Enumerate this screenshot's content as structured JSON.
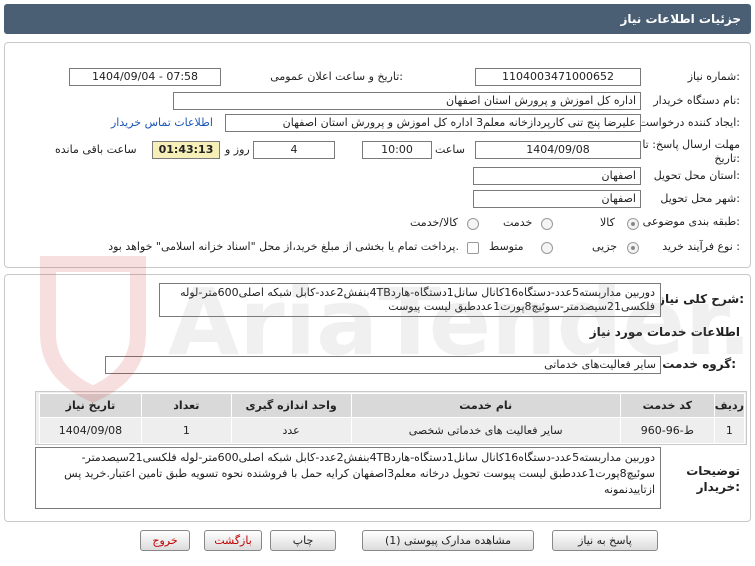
{
  "header": {
    "title": "جزئیات اطلاعات نیاز"
  },
  "fields": {
    "need_number_label": "شماره نیاز:",
    "need_number": "1104003471000652",
    "announce_label": "تاریخ و ساعت اعلان عمومی:",
    "announce_value": "1404/09/04 - 07:58",
    "buyer_label": "نام دستگاه خریدار:",
    "buyer_value": "اداره کل اموزش و پرورش استان اصفهان",
    "creator_label": "ایجاد کننده درخواست:",
    "creator_value": "علیرضا پنج تنی کارپردازخانه معلم3 اداره کل اموزش و پرورش استان اصفهان",
    "contact_link": "اطلاعات تماس خریدار",
    "deadline_label": "مهلت ارسال پاسخ: تا تاریخ:",
    "deadline_date": "1404/09/08",
    "time_label": "ساعت",
    "deadline_time": "10:00",
    "days_value": "4",
    "days_label": "روز و",
    "remaining_time": "01:43:13",
    "remaining_label": "ساعت باقی مانده",
    "province_label": "استان محل تحویل:",
    "province_value": "اصفهان",
    "city_label": "شهر محل تحویل:",
    "city_value": "اصفهان",
    "category_label": "طبقه بندی موضوعی:",
    "category_options": [
      "کالا",
      "خدمت",
      "کالا/خدمت"
    ],
    "process_label": "نوع فرآیند خرید :",
    "process_options": [
      "جزیی",
      "متوسط"
    ],
    "payment_note": "پرداخت تمام یا بخشی از مبلغ خرید،از محل \"اسناد خزانه اسلامی\" خواهد بود."
  },
  "summary": {
    "label": "شرح کلی نیاز:",
    "text": "دوربین مداربسته5عدد-دستگاه16کانال سانل1دستگاه-هارد4TBبنفش2عدد-کابل شبکه اصلی600متر-لوله فلکسی21سیصدمتر-سوئیچ8پورت1عددطبق لیست پیوست"
  },
  "services": {
    "title": "اطلاعات خدمات مورد نیاز",
    "group_label": "گروه خدمت:",
    "group_value": "سایر فعالیت‌های خدماتی",
    "columns": [
      "ردیف",
      "کد خدمت",
      "نام خدمت",
      "واحد اندازه گیری",
      "تعداد",
      "تاریخ نیاز"
    ],
    "rows": [
      [
        "1",
        "ط-96-960",
        "سایر فعالیت های خدماتی شخصی",
        "عدد",
        "1",
        "1404/09/08"
      ]
    ]
  },
  "buyer_notes": {
    "label": "توضیحات خریدار:",
    "text": "دوربین مداربسته5عدد-دستگاه16کانال سانل1دستگاه-هارد4TBبنفش2عدد-کابل شبکه اصلی600متر-لوله فلکسی21سیصدمتر-سوئیچ8پورت1عددطبق لیست پیوست تحویل درخانه معلم3اصفهان کرایه حمل با فروشنده نحوه تسویه طبق تامین اعتبار.خرید پس ازتاییدنمونه"
  },
  "buttons": {
    "reply": "پاسخ به نیاز",
    "attachments": "مشاهده مدارک پیوستی (1)",
    "print": "چاپ",
    "back": "بازگشت",
    "exit": "خروج"
  },
  "watermark": {
    "text": "AriaTender.neT"
  },
  "colors": {
    "header_bg": "#4a5f73",
    "timer_bg": "#f6f0b8",
    "link": "#1a56b8",
    "exit_text": "#c20000"
  }
}
